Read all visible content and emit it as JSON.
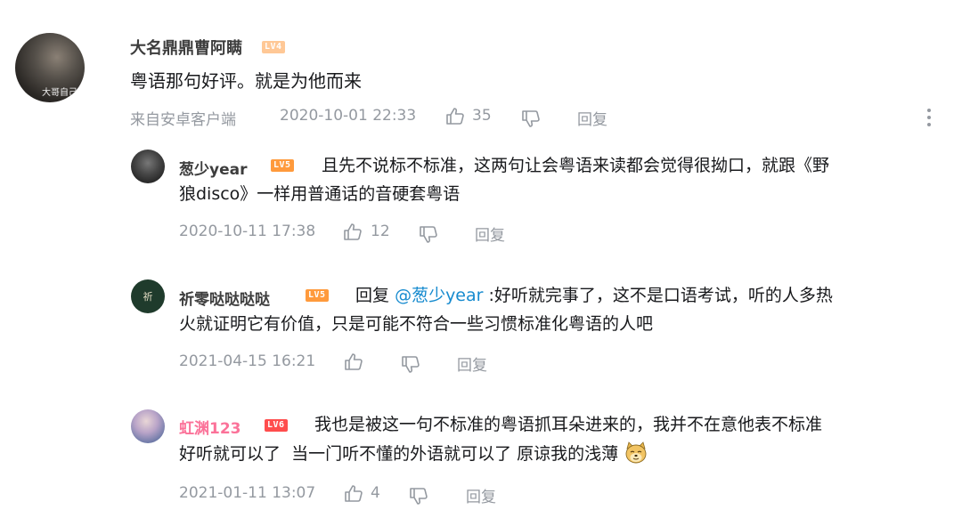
{
  "main_comment": {
    "avatar_caption": "大哥自己",
    "username": "大名鼎鼎曹阿瞒",
    "level": "LV4",
    "text": "粤语那句好评。就是为他而来",
    "source": "来自安卓客户端",
    "timestamp": "2020-10-01 22:33",
    "likes": "35",
    "reply_label": "回复"
  },
  "replies": [
    {
      "username": "葱少year",
      "username_color": "#3d3d3d",
      "level": "LV5",
      "text_line1": "且先不说标不标准，这两句让会粤语来读都会觉得很拗口，就跟《野",
      "text_line2": "狼disco》一样用普通话的音硬套粤语",
      "timestamp": "2020-10-11 17:38",
      "likes": "12",
      "reply_label": "回复"
    },
    {
      "username": "祈零哒哒哒哒",
      "username_color": "#3d3d3d",
      "level": "LV5",
      "reply_prefix": "回复",
      "at_user": "@葱少year",
      "text_line1": ":好听就完事了，这不是口语考试，听的人多热",
      "text_line2": "火就证明它有价值，只是可能不符合一些习惯标准化粤语的人吧",
      "avatar_glyph": "祈",
      "timestamp": "2021-04-15 16:21",
      "likes": "",
      "reply_label": "回复"
    },
    {
      "username": "虹渊123",
      "username_color": "#fb7299",
      "level": "LV6",
      "text_line1": "我也是被这一句不标准的粤语抓耳朵进来的，我并不在意他表不标准",
      "text_line2": "好听就可以了  当一门听不懂的外语就可以了 原谅我的浅薄",
      "emoji": "doge-emoji",
      "timestamp": "2021-01-11 13:07",
      "likes": "4",
      "reply_label": "回复"
    }
  ],
  "colors": {
    "meta_gray": "#9499a0",
    "link_blue": "#178bcf",
    "lv4": "#ffc896",
    "lv5": "#ff9a3c",
    "lv6": "#ff4d4d"
  }
}
